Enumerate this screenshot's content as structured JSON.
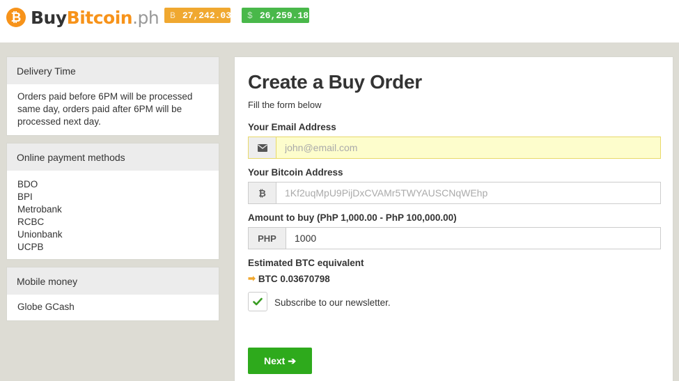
{
  "header": {
    "logo": {
      "buy": "Buy",
      "bitcoin": "Bitcoin",
      "ph": ".ph",
      "icon": "bitcoin-logo-icon"
    },
    "ticker_buy": {
      "symbol": "B",
      "value": "27,242.03",
      "color": "#f0a830"
    },
    "ticker_sell": {
      "symbol": "$",
      "value": "26,259.18",
      "color": "#49b84a"
    }
  },
  "sidebar": {
    "delivery": {
      "title": "Delivery Time",
      "text": "Orders paid before 6PM will be processed same day, orders paid after 6PM will be processed next day."
    },
    "online": {
      "title": "Online payment methods",
      "items": [
        "BDO",
        "BPI",
        "Metrobank",
        "RCBC",
        "Unionbank",
        "UCPB"
      ]
    },
    "mobile": {
      "title": "Mobile money",
      "items": [
        "Globe GCash"
      ]
    }
  },
  "form": {
    "title": "Create a Buy Order",
    "subtitle": "Fill the form below",
    "email": {
      "label": "Your Email Address",
      "placeholder": "john@email.com",
      "value": "",
      "icon": "envelope-icon"
    },
    "btc_address": {
      "label": "Your Bitcoin Address",
      "placeholder": "1Kf2uqMpU9PijDxCVAMr5TWYAUSCNqWEhp",
      "value": "",
      "icon": "bitcoin-icon"
    },
    "amount": {
      "label": "Amount to buy (PhP 1,000.00 - PhP 100,000.00)",
      "addon": "PHP",
      "value": "1000"
    },
    "estimate": {
      "label": "Estimated BTC equivalent",
      "value": "BTC 0.03670798"
    },
    "newsletter": {
      "label": "Subscribe to our newsletter.",
      "checked": true
    },
    "next_label": "Next"
  },
  "colors": {
    "accent_orange": "#f7931a",
    "button_green": "#2eaa1c",
    "background": "#dddcd4"
  }
}
